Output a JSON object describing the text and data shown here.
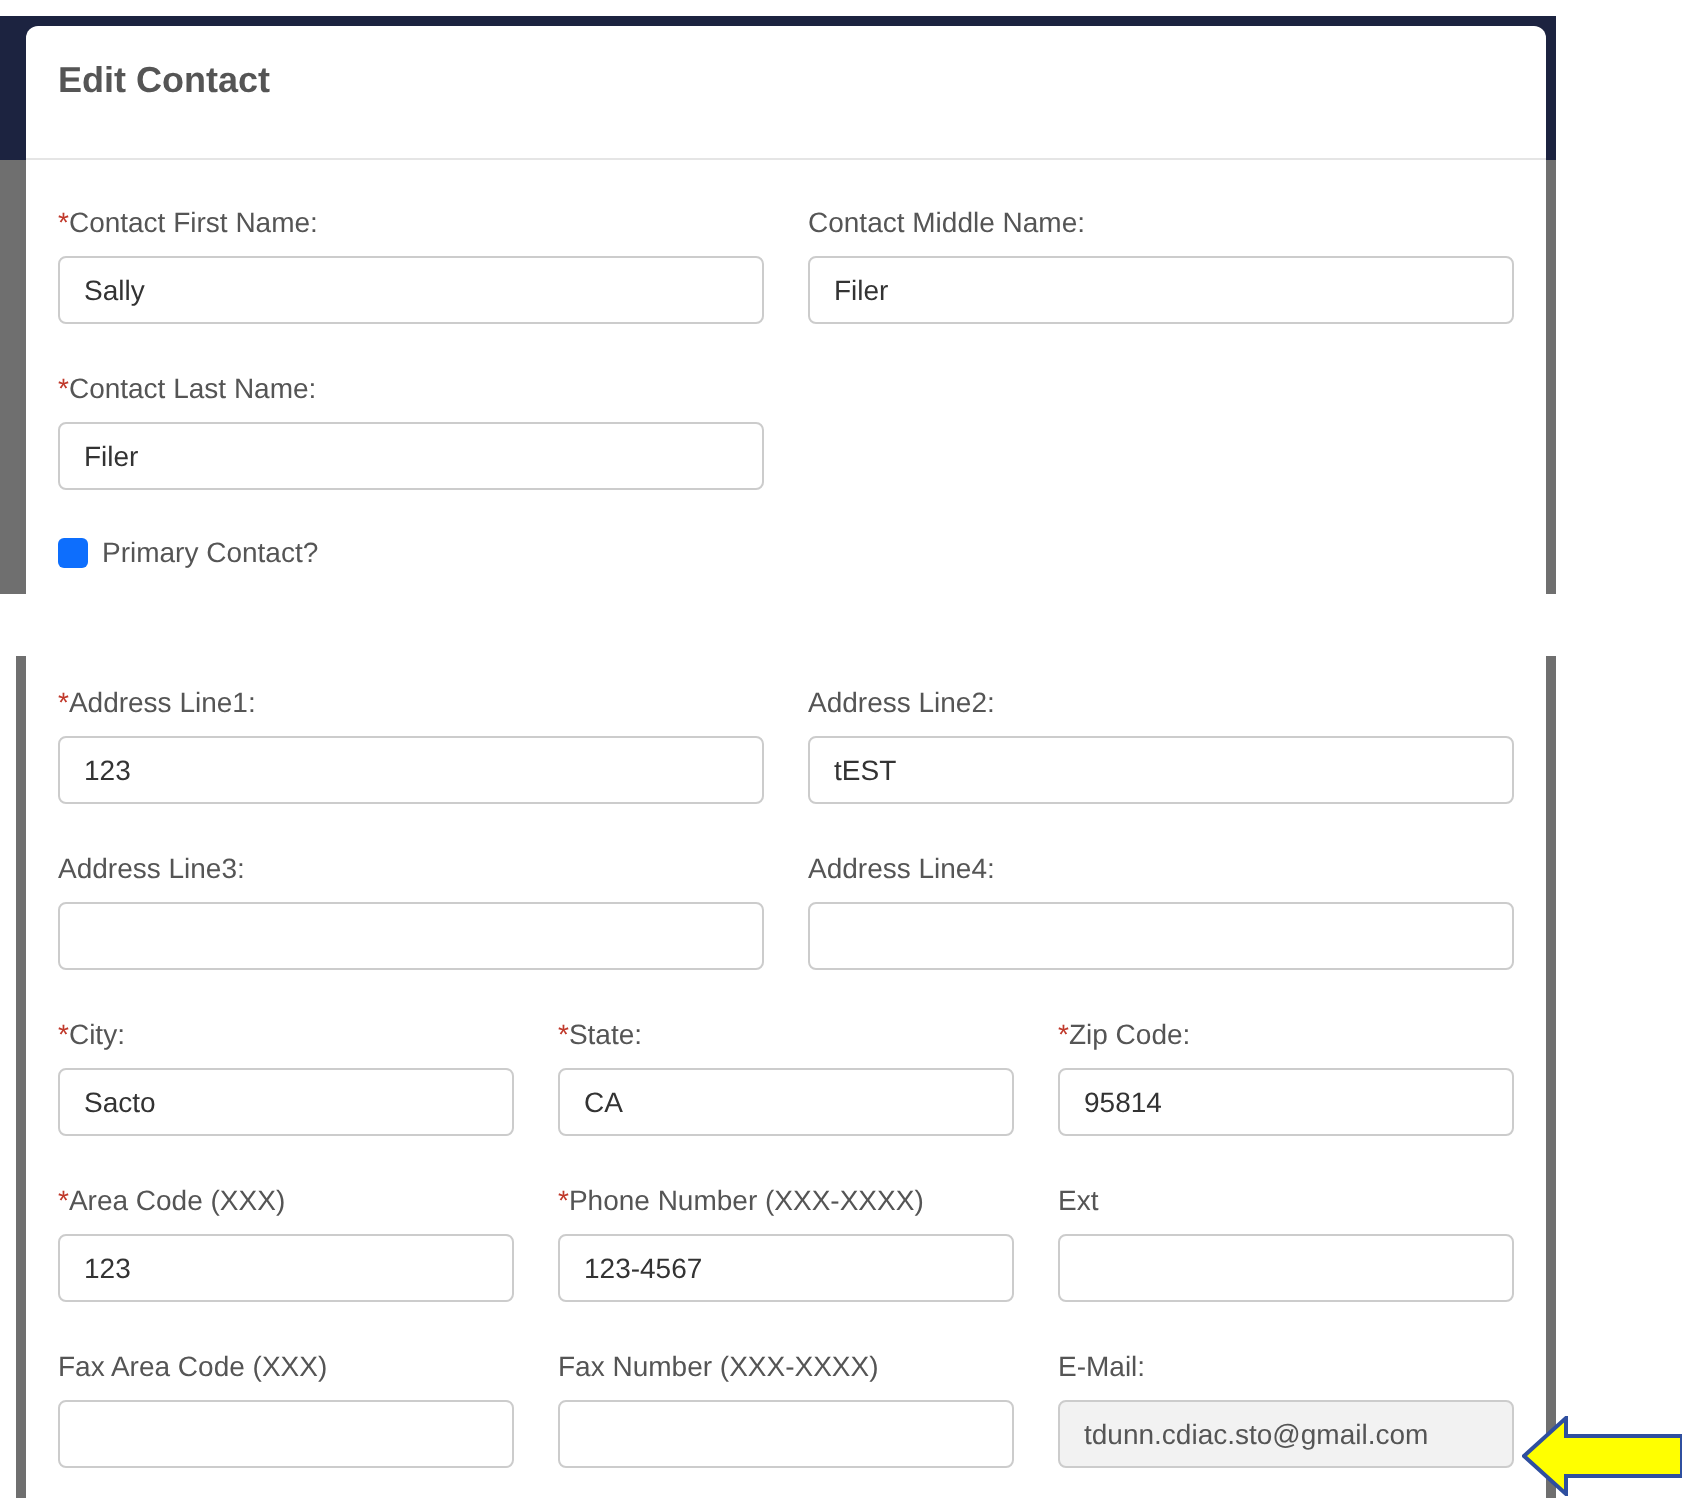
{
  "dialog": {
    "title": "Edit Contact"
  },
  "sections": [
    {
      "rows": [
        {
          "kind": "pair",
          "fields": [
            {
              "label": "Contact First Name:",
              "required_mark": "*",
              "value": "Sally",
              "disabled": false
            },
            {
              "label": "Contact Middle Name:",
              "value": "Filer",
              "disabled": false
            }
          ]
        },
        {
          "kind": "pair",
          "fields": [
            {
              "label": "Contact Last Name:",
              "required_mark": "*",
              "value": "Filer",
              "disabled": false
            }
          ]
        }
      ],
      "checkbox": {
        "label": "Primary Contact?",
        "checked": true
      }
    },
    {
      "rows": [
        {
          "kind": "pair",
          "fields": [
            {
              "label": "Address Line1:",
              "required_mark": "*",
              "value": "123",
              "disabled": false
            },
            {
              "label": "Address Line2:",
              "value": "tEST",
              "disabled": false
            }
          ]
        },
        {
          "kind": "pair",
          "fields": [
            {
              "label": "Address Line3:",
              "disabled": false
            },
            {
              "label": "Address Line4:",
              "disabled": false
            }
          ]
        },
        {
          "kind": "triple",
          "fields": [
            {
              "label": "City:",
              "required_mark": "*",
              "value": "Sacto",
              "disabled": false
            },
            {
              "label": "State:",
              "required_mark": "*",
              "value": "CA",
              "disabled": false
            },
            {
              "label": "Zip Code:",
              "required_mark": "*",
              "value": "95814",
              "disabled": false
            }
          ]
        },
        {
          "kind": "triple",
          "fields": [
            {
              "label": "Area Code (XXX)",
              "required_mark": "*",
              "value": "123",
              "disabled": false
            },
            {
              "label": "Phone Number (XXX-XXXX)",
              "required_mark": "*",
              "value": "123-4567",
              "disabled": false
            },
            {
              "label": "Ext",
              "disabled": false
            }
          ]
        },
        {
          "kind": "triple",
          "fields": [
            {
              "label": "Fax Area Code (XXX)",
              "disabled": false
            },
            {
              "label": "Fax Number (XXX-XXXX)",
              "disabled": false
            },
            {
              "label": "E-Mail:",
              "value": "tdunn.cdiac.sto@gmail.com",
              "disabled": true
            }
          ]
        }
      ]
    }
  ]
}
